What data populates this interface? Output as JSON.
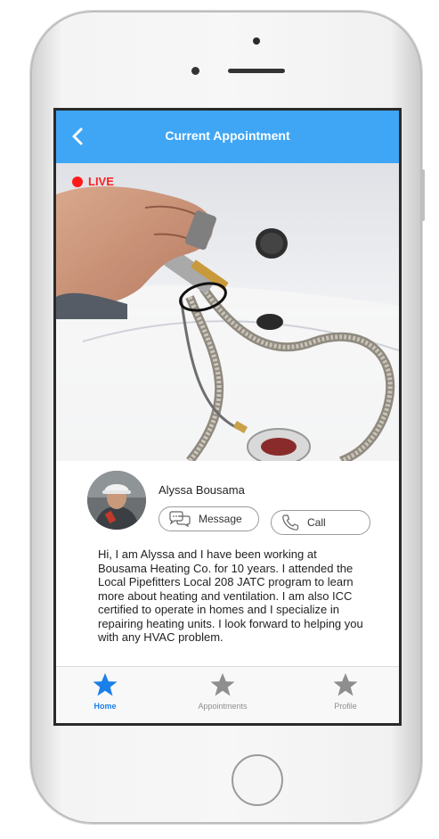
{
  "header": {
    "title": "Current Appointment",
    "back_icon": "chevron-left-icon"
  },
  "video": {
    "live_label": "LIVE",
    "live_color": "#ff1a1a"
  },
  "technician": {
    "name": "Alyssa Bousama",
    "message_label": "Message",
    "call_label": "Call",
    "bio": "Hi, I am Alyssa and I have been working at Bousama Heating Co. for 10 years. I attended the Local Pipefitters Local 208 JATC program to learn more about heating and ventilation. I am also ICC certified to operate in homes and I specialize in repairing heating units. I look forward to helping you with any HVAC problem."
  },
  "tabbar": {
    "tabs": [
      {
        "label": "Home",
        "icon": "star-icon",
        "active": true
      },
      {
        "label": "Appointments",
        "icon": "star-icon",
        "active": false
      },
      {
        "label": "Profile",
        "icon": "star-icon",
        "active": false
      }
    ]
  },
  "colors": {
    "accent": "#3fa6f5",
    "tab_active": "#1a7fe8",
    "tab_inactive": "#8e8e8e"
  }
}
